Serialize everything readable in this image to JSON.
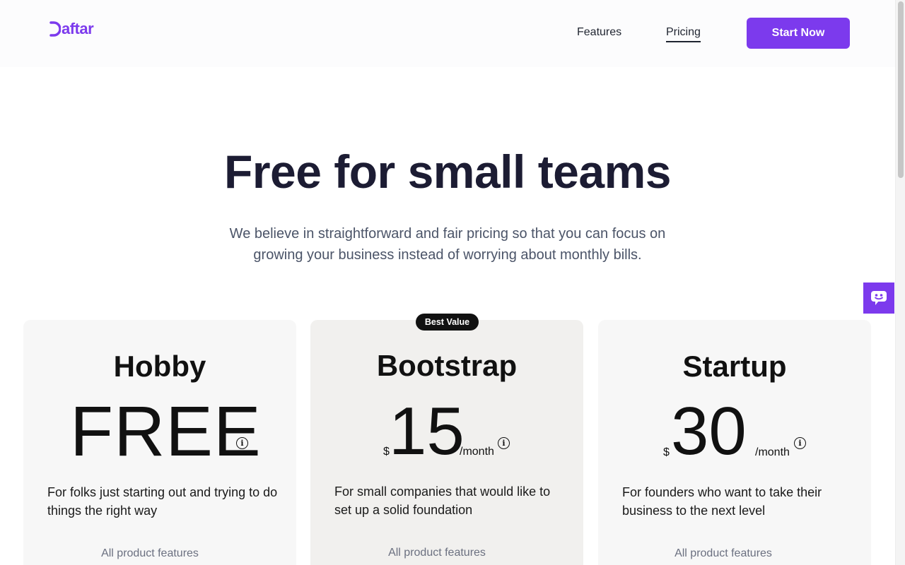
{
  "brand": {
    "name": "Daftar",
    "accent": "#7c3aed"
  },
  "nav": {
    "features": "Features",
    "pricing": "Pricing",
    "cta": "Start Now"
  },
  "hero": {
    "title": "Free for small teams",
    "subtitle": "We believe in straightforward and fair pricing so that you can focus on growing your business instead of worrying about monthly bills."
  },
  "plans": [
    {
      "name": "Hobby",
      "price": "FREE",
      "currency": "",
      "period": "",
      "description": "For folks just starting out and trying to do things the right way",
      "features_label": "All product features"
    },
    {
      "name": "Bootstrap",
      "price": "15",
      "currency": "$",
      "period": "/month",
      "badge": "Best Value",
      "description": "For small companies that would like to set up a solid foundation",
      "features_label": "All product features"
    },
    {
      "name": "Startup",
      "price": "30",
      "currency": "$",
      "period": "/month",
      "description": "For founders who want to take their business to the next level",
      "features_label": "All product features"
    }
  ],
  "icons": {
    "info": "info-icon",
    "chat": "chat-icon",
    "logo": "daftar-logo"
  }
}
